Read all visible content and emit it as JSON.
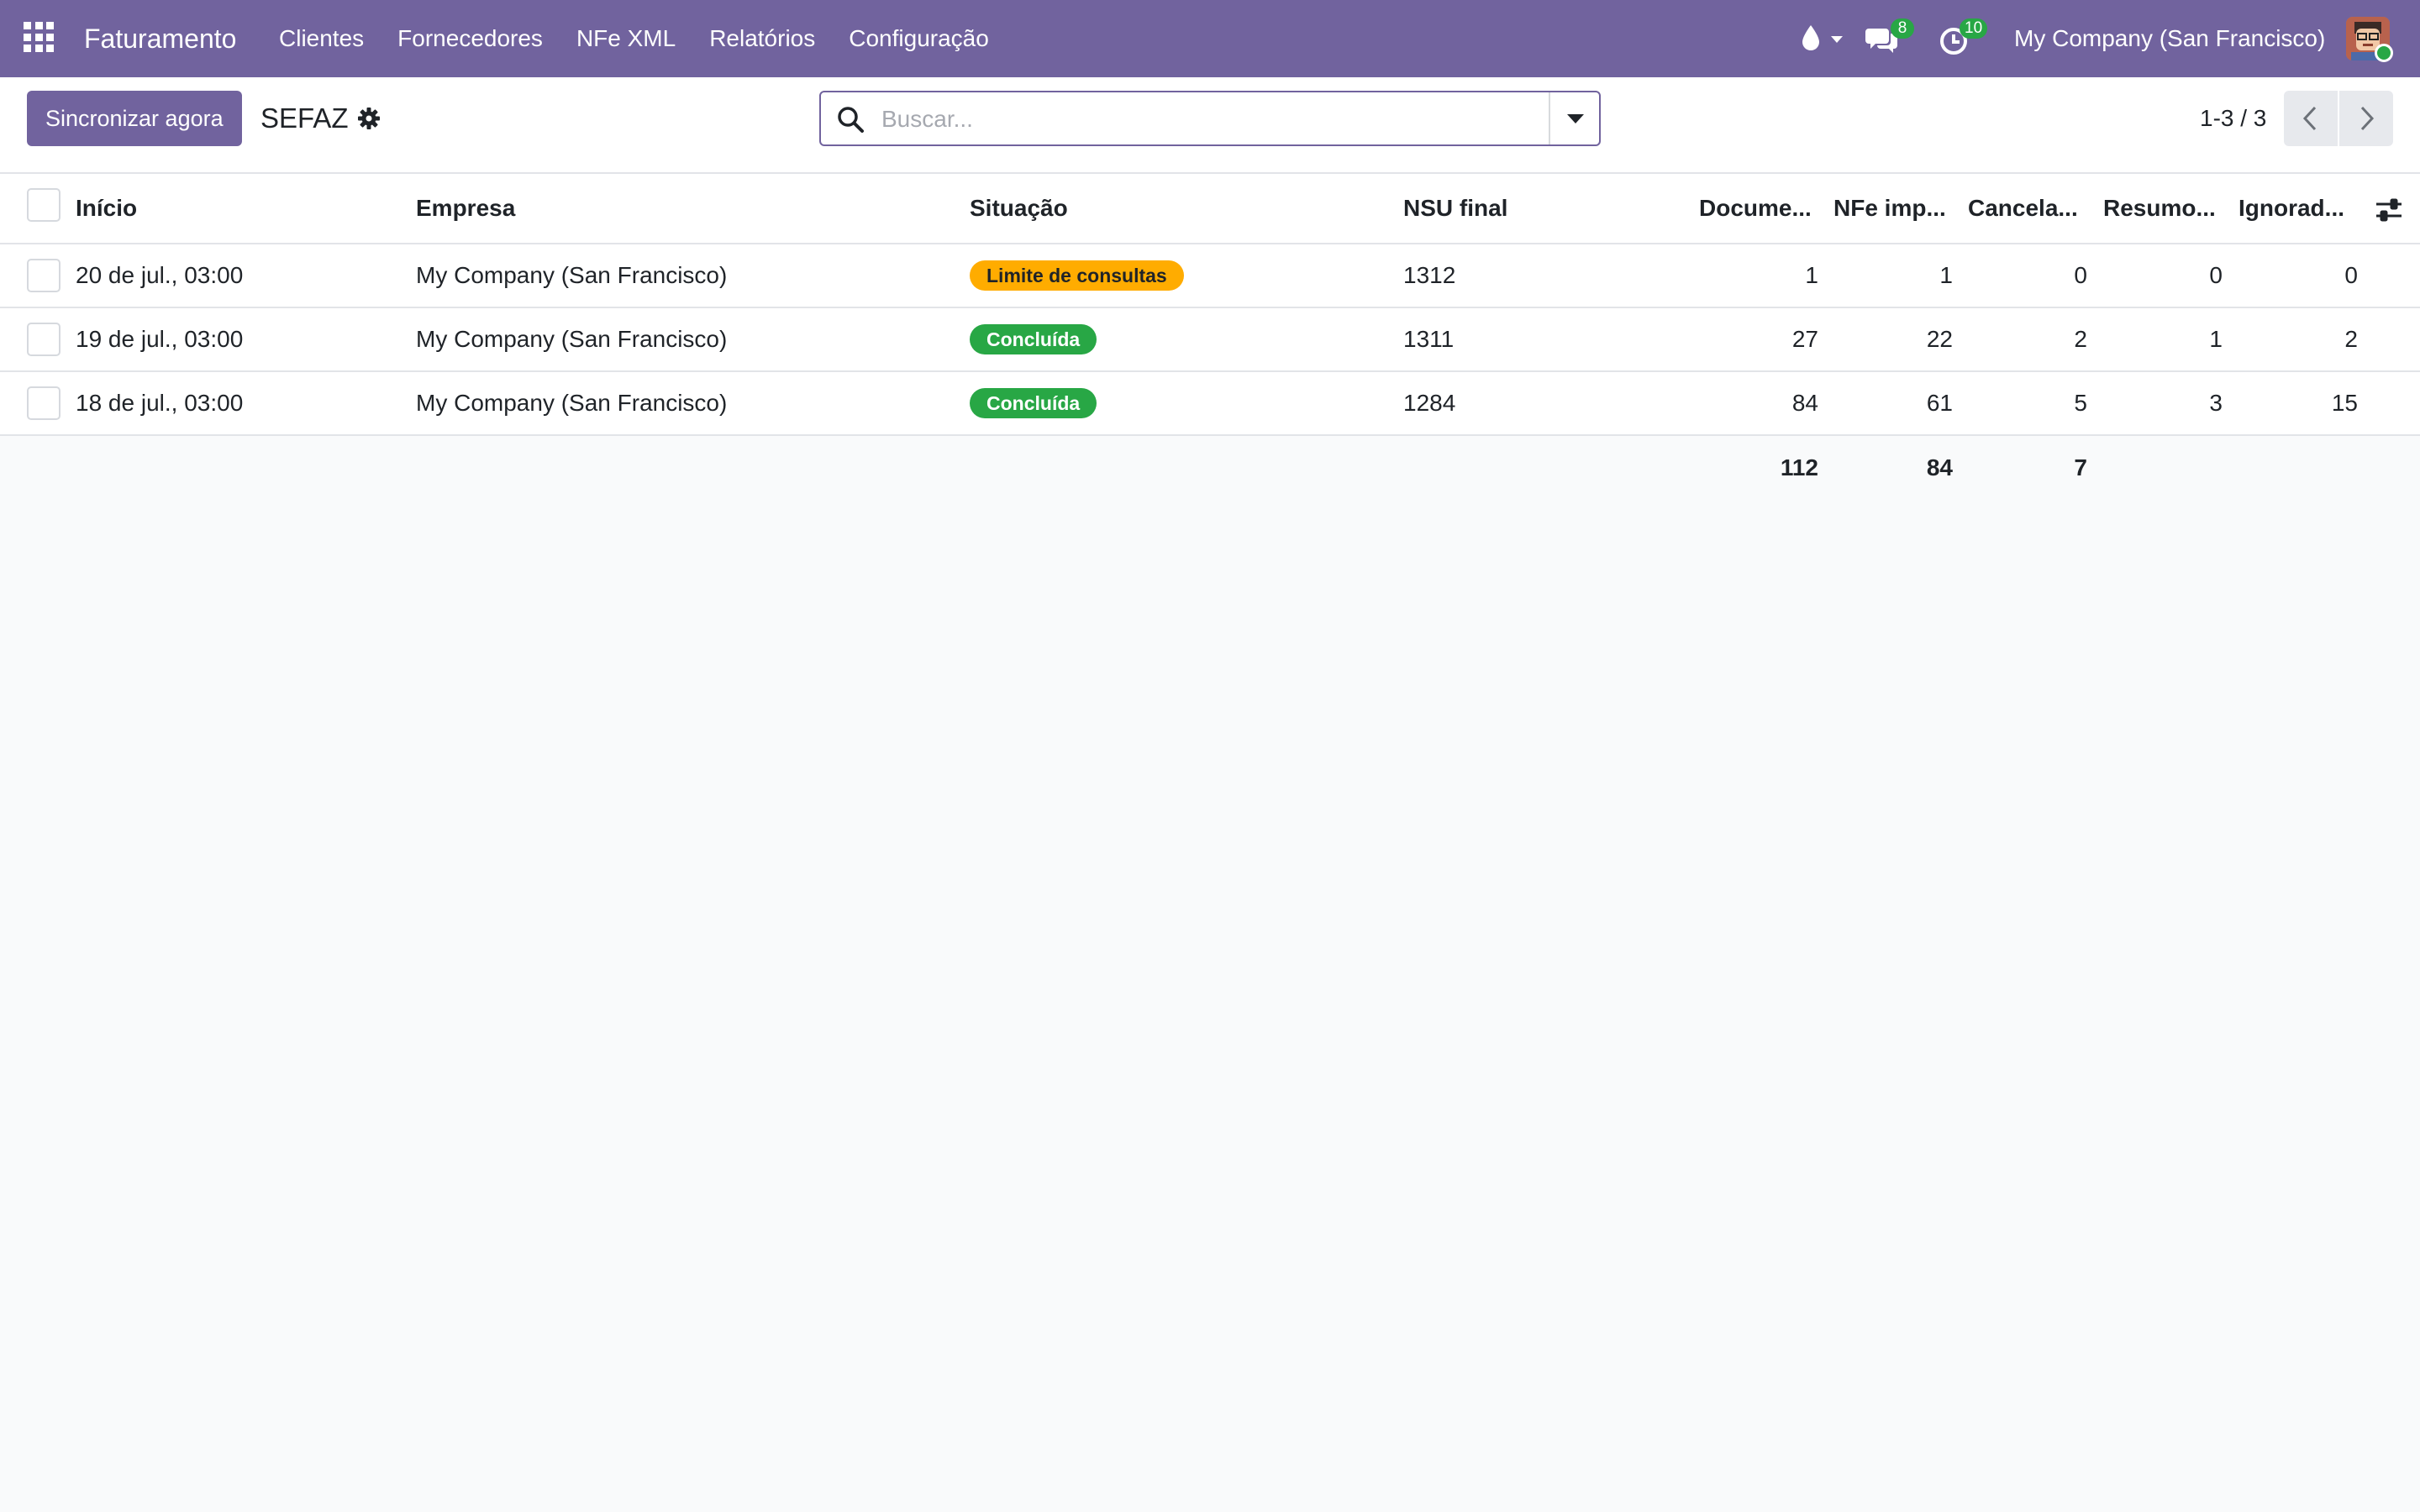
{
  "navbar": {
    "brand": "Faturamento",
    "menu": [
      "Clientes",
      "Fornecedores",
      "NFe XML",
      "Relatórios",
      "Configuração"
    ],
    "messages_count": "8",
    "activities_count": "10",
    "company": "My Company (San Francisco)",
    "color": "#71639e"
  },
  "control_panel": {
    "sync_button": "Sincronizar agora",
    "title": "SEFAZ",
    "search_placeholder": "Buscar...",
    "pager": "1-3 / 3"
  },
  "table": {
    "headers": [
      "Início",
      "Empresa",
      "Situação",
      "NSU final",
      "Docume...",
      "NFe imp...",
      "Cancela...",
      "Resumo...",
      "Ignorad..."
    ],
    "rows": [
      {
        "start": "20 de jul., 03:00",
        "company": "My Company (San Francisco)",
        "status": "Limite de consultas",
        "status_color": "#ffac00",
        "nsu": "1312",
        "docs": "1",
        "nfe": "1",
        "cancel": "0",
        "summary": "0",
        "ignored": "0"
      },
      {
        "start": "19 de jul., 03:00",
        "company": "My Company (San Francisco)",
        "status": "Concluída",
        "status_color": "#28a745",
        "nsu": "1311",
        "docs": "27",
        "nfe": "22",
        "cancel": "2",
        "summary": "1",
        "ignored": "2"
      },
      {
        "start": "18 de jul., 03:00",
        "company": "My Company (San Francisco)",
        "status": "Concluída",
        "status_color": "#28a745",
        "nsu": "1284",
        "docs": "84",
        "nfe": "61",
        "cancel": "5",
        "summary": "3",
        "ignored": "15"
      }
    ],
    "totals": {
      "docs": "112",
      "nfe": "84",
      "cancel": "7"
    }
  }
}
